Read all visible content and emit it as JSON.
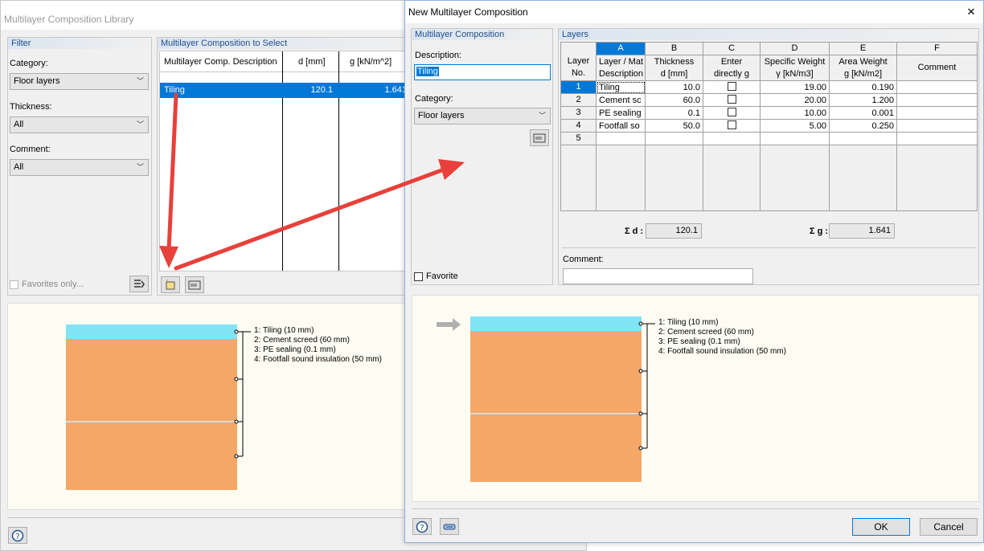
{
  "library": {
    "title": "Multilayer Composition Library",
    "filter": {
      "header": "Filter",
      "category_label": "Category:",
      "category_value": "Floor layers",
      "thickness_label": "Thickness:",
      "thickness_value": "All",
      "comment_label": "Comment:",
      "comment_value": "All",
      "favorites_label": "Favorites only..."
    },
    "select": {
      "header": "Multilayer Composition to Select",
      "columns": [
        "Multilayer Comp. Description",
        "d [mm]",
        "g [kN/m^2]"
      ],
      "rows": [
        {
          "description": "Tiling",
          "d": "120.1",
          "g": "1.641"
        }
      ]
    },
    "legend": [
      "1: Tiling (10 mm)",
      "2: Cement screed (60 mm)",
      "3: PE sealing (0.1 mm)",
      "4: Footfall sound insulation (50 mm)"
    ]
  },
  "dialog": {
    "title": "New Multilayer Composition",
    "close_glyph": "✕",
    "composition": {
      "header": "Multilayer Composition",
      "description_label": "Description:",
      "description_value": "Tiling",
      "category_label": "Category:",
      "category_value": "Floor layers",
      "favorite_label": "Favorite"
    },
    "layers": {
      "header": "Layers",
      "col_letters": [
        "A",
        "B",
        "C",
        "D",
        "E",
        "F"
      ],
      "head_layer_no": [
        "Layer",
        "No."
      ],
      "head_a": [
        "Layer / Mat",
        "Description"
      ],
      "head_b": [
        "Thickness",
        "d [mm]"
      ],
      "head_c": [
        "Enter",
        "directly g"
      ],
      "head_d": [
        "Specific Weight",
        "γ [kN/m3]"
      ],
      "head_e": [
        "Area Weight",
        "g [kN/m2]"
      ],
      "head_f": [
        "",
        "Comment"
      ],
      "rows": [
        {
          "no": "1",
          "desc": "Tiling",
          "d": "10.0",
          "gamma": "19.00",
          "g": "0.190"
        },
        {
          "no": "2",
          "desc": "Cement sc",
          "d": "60.0",
          "gamma": "20.00",
          "g": "1.200"
        },
        {
          "no": "3",
          "desc": "PE sealing",
          "d": "0.1",
          "gamma": "10.00",
          "g": "0.001"
        },
        {
          "no": "4",
          "desc": "Footfall so",
          "d": "50.0",
          "gamma": "5.00",
          "g": "0.250"
        },
        {
          "no": "5",
          "desc": "",
          "d": "",
          "gamma": "",
          "g": ""
        }
      ],
      "sum_d_label": "Σ d :",
      "sum_d_value": "120.1",
      "sum_g_label": "Σ g :",
      "sum_g_value": "1.641",
      "comment_label": "Comment:",
      "comment_value": ""
    },
    "legend": [
      "1: Tiling (10 mm)",
      "2: Cement screed (60 mm)",
      "3: PE sealing (0.1 mm)",
      "4: Footfall sound insulation (50 mm)"
    ],
    "ok_label": "OK",
    "cancel_label": "Cancel"
  },
  "colors": {
    "tiling": "#80e4f4",
    "screed": "#f4a766",
    "arrow": "#e8403a",
    "selection": "#0078d7"
  }
}
